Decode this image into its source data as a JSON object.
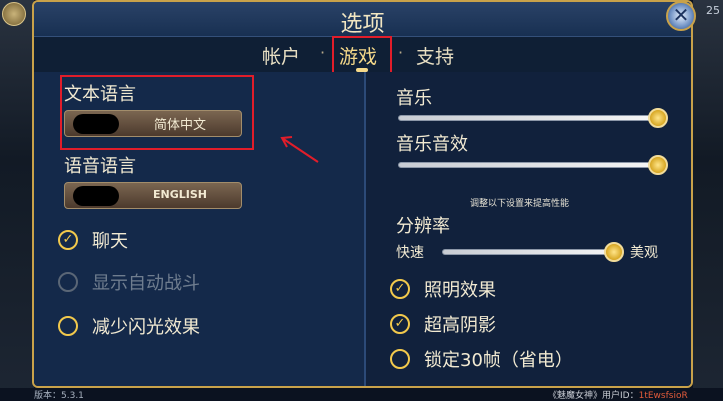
{
  "window": {
    "title": "选项",
    "close_icon": "close-icon",
    "corner_number": "25"
  },
  "tabs": [
    {
      "label": "帐户",
      "active": false
    },
    {
      "label": "游戏",
      "active": true
    },
    {
      "label": "支持",
      "active": false
    }
  ],
  "left_panel": {
    "text_language": {
      "label": "文本语言",
      "value": "简体中文"
    },
    "voice_language": {
      "label": "语音语言",
      "value": "ENGLISH"
    },
    "options": [
      {
        "label": "聊天",
        "checked": true,
        "enabled": true
      },
      {
        "label": "显示自动战斗",
        "checked": false,
        "enabled": false
      },
      {
        "label": "减少闪光效果",
        "checked": false,
        "enabled": true
      }
    ]
  },
  "right_panel": {
    "music": {
      "label": "音乐",
      "level": 1.0
    },
    "sound_effects": {
      "label": "音乐音效",
      "level": 1.0
    },
    "performance_note": "调整以下设置来提高性能",
    "resolution": {
      "label": "分辨率",
      "min_label": "快速",
      "max_label": "美观",
      "level": 1.0
    },
    "options": [
      {
        "label": "照明效果",
        "checked": true
      },
      {
        "label": "超高阴影",
        "checked": true
      },
      {
        "label": "锁定30帧（省电）",
        "checked": false
      }
    ]
  },
  "footer": {
    "version": "版本：5.3.1",
    "user_prefix": "《魅魔女神》用户ID：",
    "user_id": "1tEwsfsioR"
  },
  "colors": {
    "accent_gold": "#f2c94c",
    "highlight_red": "#e11d2a",
    "panel_bg": "#14294a"
  }
}
